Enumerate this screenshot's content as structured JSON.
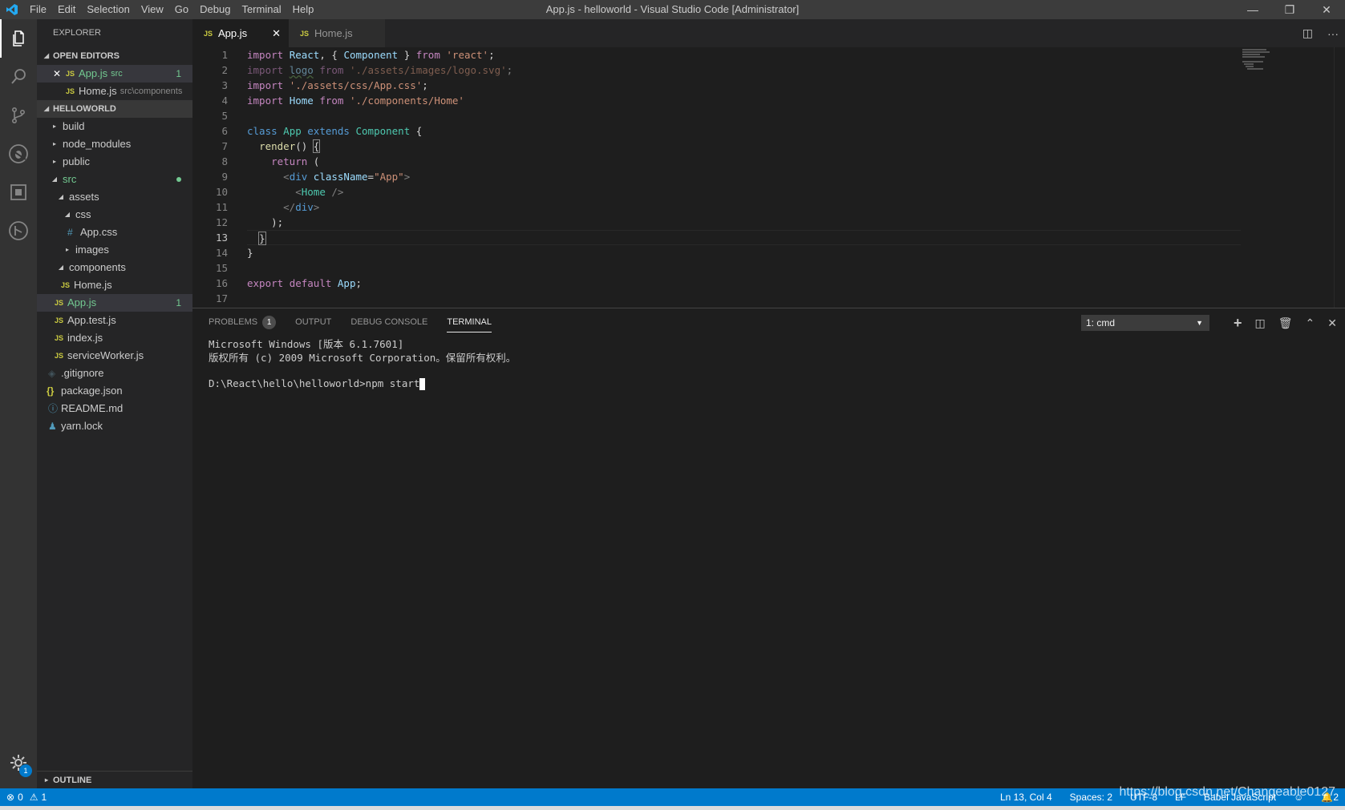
{
  "window": {
    "title": "App.js - helloworld - Visual Studio Code [Administrator]",
    "menu": [
      "File",
      "Edit",
      "Selection",
      "View",
      "Go",
      "Debug",
      "Terminal",
      "Help"
    ],
    "controls": {
      "minimize": "—",
      "restore": "❐",
      "close": "✕"
    }
  },
  "activity": {
    "items": [
      "explorer-icon",
      "search-icon",
      "source-control-icon",
      "debug-icon",
      "extensions-icon",
      "remote-icon"
    ],
    "settings_badge": "1"
  },
  "sidebar": {
    "title": "EXPLORER",
    "open_editors": {
      "header": "OPEN EDITORS",
      "items": [
        {
          "icon": "JS",
          "name": "App.js",
          "path": "src",
          "count": "1"
        },
        {
          "icon": "JS",
          "name": "Home.js",
          "path": "src\\components"
        }
      ]
    },
    "project": {
      "header": "HELLOWORLD",
      "tree": [
        {
          "indent": 0,
          "twisty": "▸",
          "name": "build"
        },
        {
          "indent": 0,
          "twisty": "▸",
          "name": "node_modules"
        },
        {
          "indent": 0,
          "twisty": "▸",
          "name": "public"
        },
        {
          "indent": 0,
          "twisty": "◢",
          "name": "src"
        },
        {
          "indent": 1,
          "twisty": "◢",
          "name": "assets"
        },
        {
          "indent": 2,
          "twisty": "◢",
          "name": "css"
        },
        {
          "indent": 3,
          "icon": "#",
          "name": "App.css"
        },
        {
          "indent": 2,
          "twisty": "▸",
          "name": "images"
        },
        {
          "indent": 1,
          "twisty": "◢",
          "name": "components"
        },
        {
          "indent": 2,
          "icon": "JS",
          "name": "Home.js"
        },
        {
          "indent": 1,
          "icon": "JS",
          "name": "App.js",
          "count": "1"
        },
        {
          "indent": 1,
          "icon": "JS",
          "name": "App.test.js"
        },
        {
          "indent": 1,
          "icon": "JS",
          "name": "index.js"
        },
        {
          "indent": 1,
          "icon": "JS",
          "name": "serviceWorker.js"
        },
        {
          "indent": 0,
          "icon": "◈",
          "name": ".gitignore"
        },
        {
          "indent": 0,
          "icon": "{}",
          "name": "package.json"
        },
        {
          "indent": 0,
          "icon": "ⓘ",
          "name": "README.md"
        },
        {
          "indent": 0,
          "icon": "♟",
          "name": "yarn.lock"
        }
      ]
    },
    "outline_header": "OUTLINE"
  },
  "tabs": [
    {
      "icon": "JS",
      "label": "App.js",
      "close": "✕"
    },
    {
      "icon": "JS",
      "label": "Home.js"
    }
  ],
  "editor": {
    "line_numbers": [
      "1",
      "2",
      "3",
      "4",
      "5",
      "6",
      "7",
      "8",
      "9",
      "10",
      "11",
      "12",
      "13",
      "14",
      "15",
      "16",
      "17"
    ],
    "current_line": "13"
  },
  "panel": {
    "tabs": [
      "PROBLEMS",
      "OUTPUT",
      "DEBUG CONSOLE",
      "TERMINAL"
    ],
    "problems_count": "1",
    "terminal_select": "1: cmd",
    "terminal_lines": [
      "Microsoft Windows [版本 6.1.7601]",
      "版权所有 (c) 2009 Microsoft Corporation。保留所有权利。",
      "",
      "D:\\React\\hello\\helloworld>npm start"
    ]
  },
  "status": {
    "errors": "0",
    "warnings": "1",
    "position": "Ln 13, Col 4",
    "spaces": "Spaces: 2",
    "encoding": "UTF-8",
    "eol": "LF",
    "language": "Babel JavaScript",
    "notifications": "2",
    "watermark": "https://blog.csdn.net/Changeable0127"
  }
}
